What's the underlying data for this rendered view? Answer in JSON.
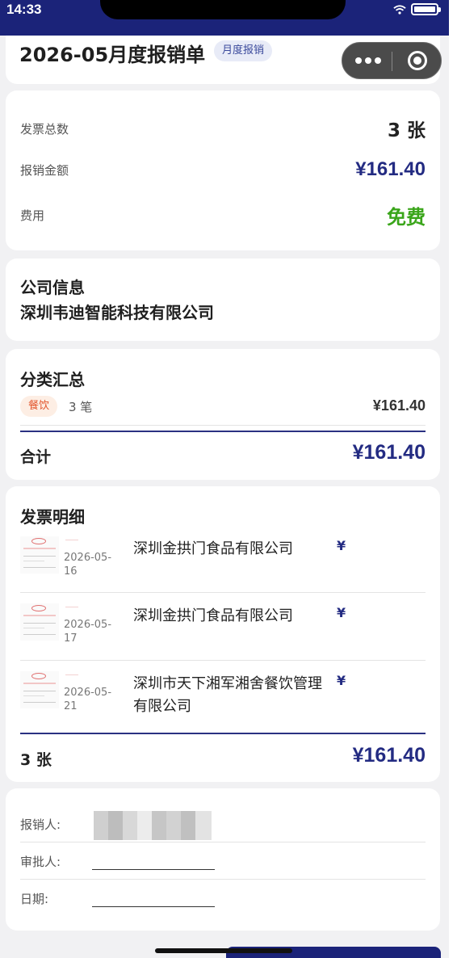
{
  "status_bar": {
    "time": "14:33"
  },
  "header": {
    "title": "2026-05月度报销单",
    "tag": "月度报销"
  },
  "summary": {
    "invoice_count_label": "发票总数",
    "invoice_count_value": "3 张",
    "amount_label": "报销金额",
    "amount_value": "¥161.40",
    "fee_label": "费用",
    "fee_value": "免费"
  },
  "company": {
    "section_title": "公司信息",
    "name": "深圳韦迪智能科技有限公司"
  },
  "category": {
    "section_title": "分类汇总",
    "items": [
      {
        "tag": "餐饮",
        "count": "3 笔",
        "amount": "¥161.40"
      }
    ],
    "total_label": "合计",
    "total_amount": "¥161.40"
  },
  "invoices": {
    "section_title": "发票明细",
    "items": [
      {
        "date": "2026-05-16",
        "vendor": "深圳金拱门食品有限公司",
        "amount": "¥"
      },
      {
        "date": "2026-05-17",
        "vendor": "深圳金拱门食品有限公司",
        "amount": "¥"
      },
      {
        "date": "2026-05-21",
        "vendor": "深圳市天下湘军湘舍餐饮管理有限公司",
        "amount": "¥"
      }
    ],
    "footer_count": "3 张",
    "footer_amount": "¥161.40"
  },
  "signature": {
    "reimburser_label": "报销人:",
    "approver_label": "审批人:",
    "date_label": "日期:"
  },
  "colors": {
    "navy": "#1b2379",
    "amount": "#232b82",
    "free": "#3aa51a",
    "food_tag": "#e2532a"
  }
}
